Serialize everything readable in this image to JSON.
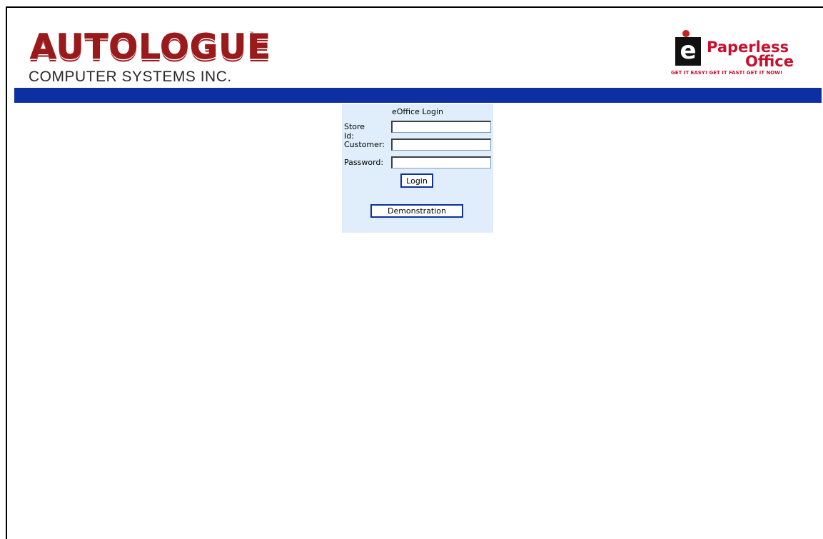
{
  "logo_left": {
    "brand": "AUTOLOGUE",
    "tm": "™",
    "sub": "COMPUTER SYSTEMS INC."
  },
  "logo_right": {
    "e": "e",
    "line1": "Paperless",
    "line2": "Office",
    "tagline": "GET IT EASY! GET IT FAST! GET IT NOW!"
  },
  "colors": {
    "bar": "#0d2fa1",
    "panel": "#dfeefa",
    "brand_red": "#9a1a1c"
  },
  "login": {
    "title": "eOffice Login",
    "store_label": "Store Id:",
    "customer_label": "Customer:",
    "password_label": "Password:",
    "store_value": "",
    "customer_value": "",
    "password_value": "",
    "login_button": "Login",
    "demo_button": "Demonstration"
  }
}
